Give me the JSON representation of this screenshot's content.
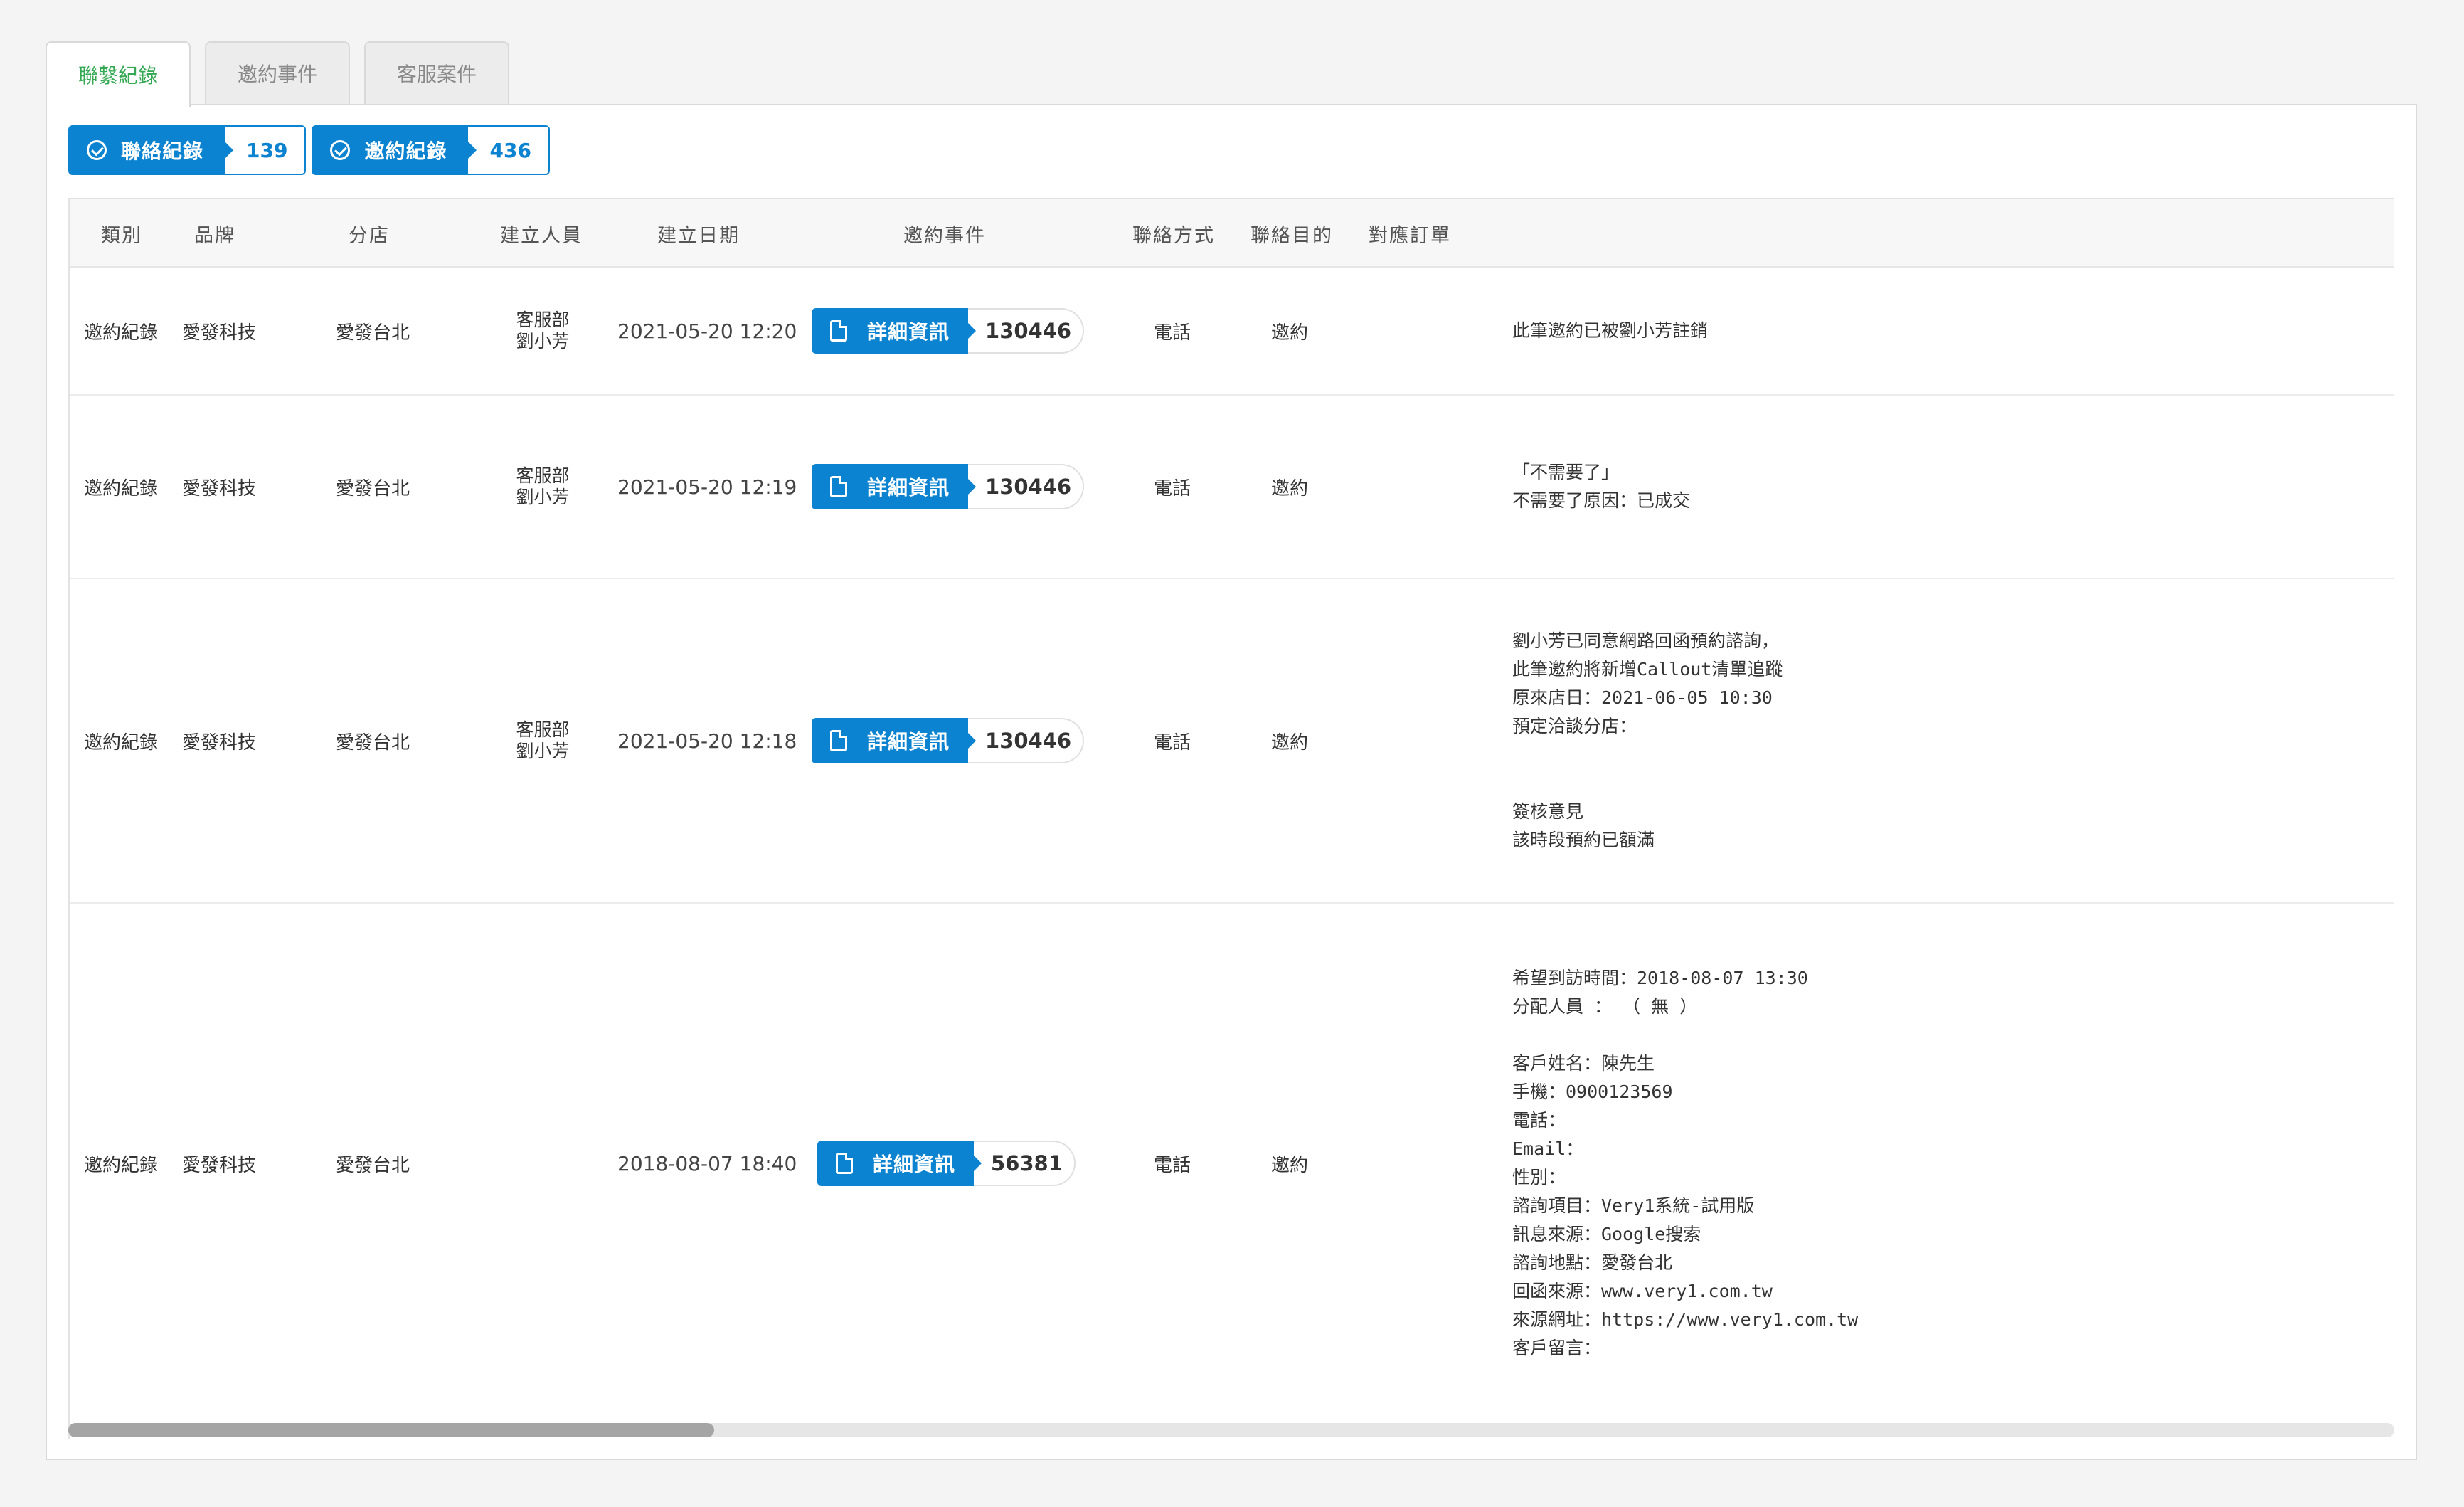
{
  "tabs": [
    {
      "label": "聯繫紀錄"
    },
    {
      "label": "邀約事件"
    },
    {
      "label": "客服案件"
    }
  ],
  "counters": [
    {
      "label": "聯絡紀錄",
      "count": "139"
    },
    {
      "label": "邀約紀錄",
      "count": "436"
    }
  ],
  "table": {
    "headers": [
      "類別",
      "品牌",
      "分店",
      "建立人員",
      "建立日期",
      "邀約事件",
      "聯絡方式",
      "聯絡目的",
      "對應訂單"
    ],
    "rows": [
      {
        "category": "邀約紀錄",
        "brand": "愛發科技",
        "branch": "愛發台北",
        "creator_dept": "客服部",
        "creator_name": "劉小芳",
        "date": "2021-05-20 12:20",
        "detail_label": "詳細資訊",
        "event_id": "130446",
        "method": "電話",
        "purpose": "邀約",
        "note": [
          "此筆邀約已被劉小芳註銷"
        ]
      },
      {
        "category": "邀約紀錄",
        "brand": "愛發科技",
        "branch": "愛發台北",
        "creator_dept": "客服部",
        "creator_name": "劉小芳",
        "date": "2021-05-20 12:19",
        "detail_label": "詳細資訊",
        "event_id": "130446",
        "method": "電話",
        "purpose": "邀約",
        "note": [
          "「不需要了」",
          "不需要了原因：已成交"
        ]
      },
      {
        "category": "邀約紀錄",
        "brand": "愛發科技",
        "branch": "愛發台北",
        "creator_dept": "客服部",
        "creator_name": "劉小芳",
        "date": "2021-05-20 12:18",
        "detail_label": "詳細資訊",
        "event_id": "130446",
        "method": "電話",
        "purpose": "邀約",
        "note": [
          "劉小芳已同意網路回函預約諮詢，",
          "此筆邀約將新增Callout清單追蹤",
          "原來店日：2021-06-05 10:30",
          "預定洽談分店：",
          "",
          "",
          "簽核意見",
          "該時段預約已額滿"
        ]
      },
      {
        "category": "邀約紀錄",
        "brand": "愛發科技",
        "branch": "愛發台北",
        "creator_dept": "",
        "creator_name": "",
        "date": "2018-08-07 18:40",
        "detail_label": "詳細資訊",
        "event_id": "56381",
        "method": "電話",
        "purpose": "邀約",
        "note": [
          "希望到訪時間：2018-08-07 13:30",
          "分配人員 ： （ 無 ）",
          "",
          "客戶姓名：陳先生",
          "手機：0900123569",
          "電話：",
          "Email：",
          "性別：",
          "諮詢項目：Very1系統-試用版",
          "訊息來源：Google搜索",
          "諮詢地點：愛發台北",
          "回函來源：www.very1.com.tw",
          "來源網址：https://www.very1.com.tw",
          "客戶留言："
        ]
      }
    ]
  },
  "colors": {
    "accent": "#0b83d0",
    "active_tab": "#34a853"
  }
}
